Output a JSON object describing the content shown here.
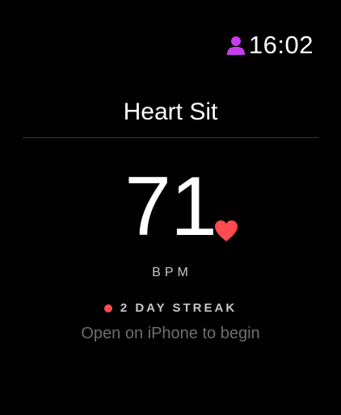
{
  "status_bar": {
    "time": "16:02",
    "user_icon": "person-icon",
    "user_icon_color": "#c83cf0"
  },
  "app": {
    "title": "Heart Sit"
  },
  "reading": {
    "bpm": "71",
    "unit": "BPM",
    "heart_icon": "heart-icon",
    "heart_color": "#ff4a4f"
  },
  "streak": {
    "label": "2 DAY STREAK",
    "dot_color": "#ff4a4f"
  },
  "hint": {
    "text": "Open on iPhone to begin"
  }
}
